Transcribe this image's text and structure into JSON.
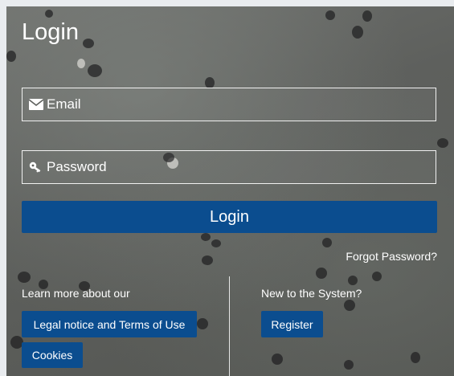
{
  "login": {
    "title": "Login",
    "email_placeholder": "Email",
    "password_placeholder": "Password",
    "login_button": "Login",
    "forgot_password": "Forgot Password?"
  },
  "footer_left": {
    "label": "Learn more about our",
    "legal_button": "Legal notice and Terms of Use",
    "cookies_button": "Cookies"
  },
  "footer_right": {
    "label": "New to the System?",
    "register_button": "Register"
  },
  "colors": {
    "primary_button": "#0b4d8f",
    "text": "#ffffff"
  },
  "icons": {
    "email": "envelope-icon",
    "password": "key-icon"
  }
}
